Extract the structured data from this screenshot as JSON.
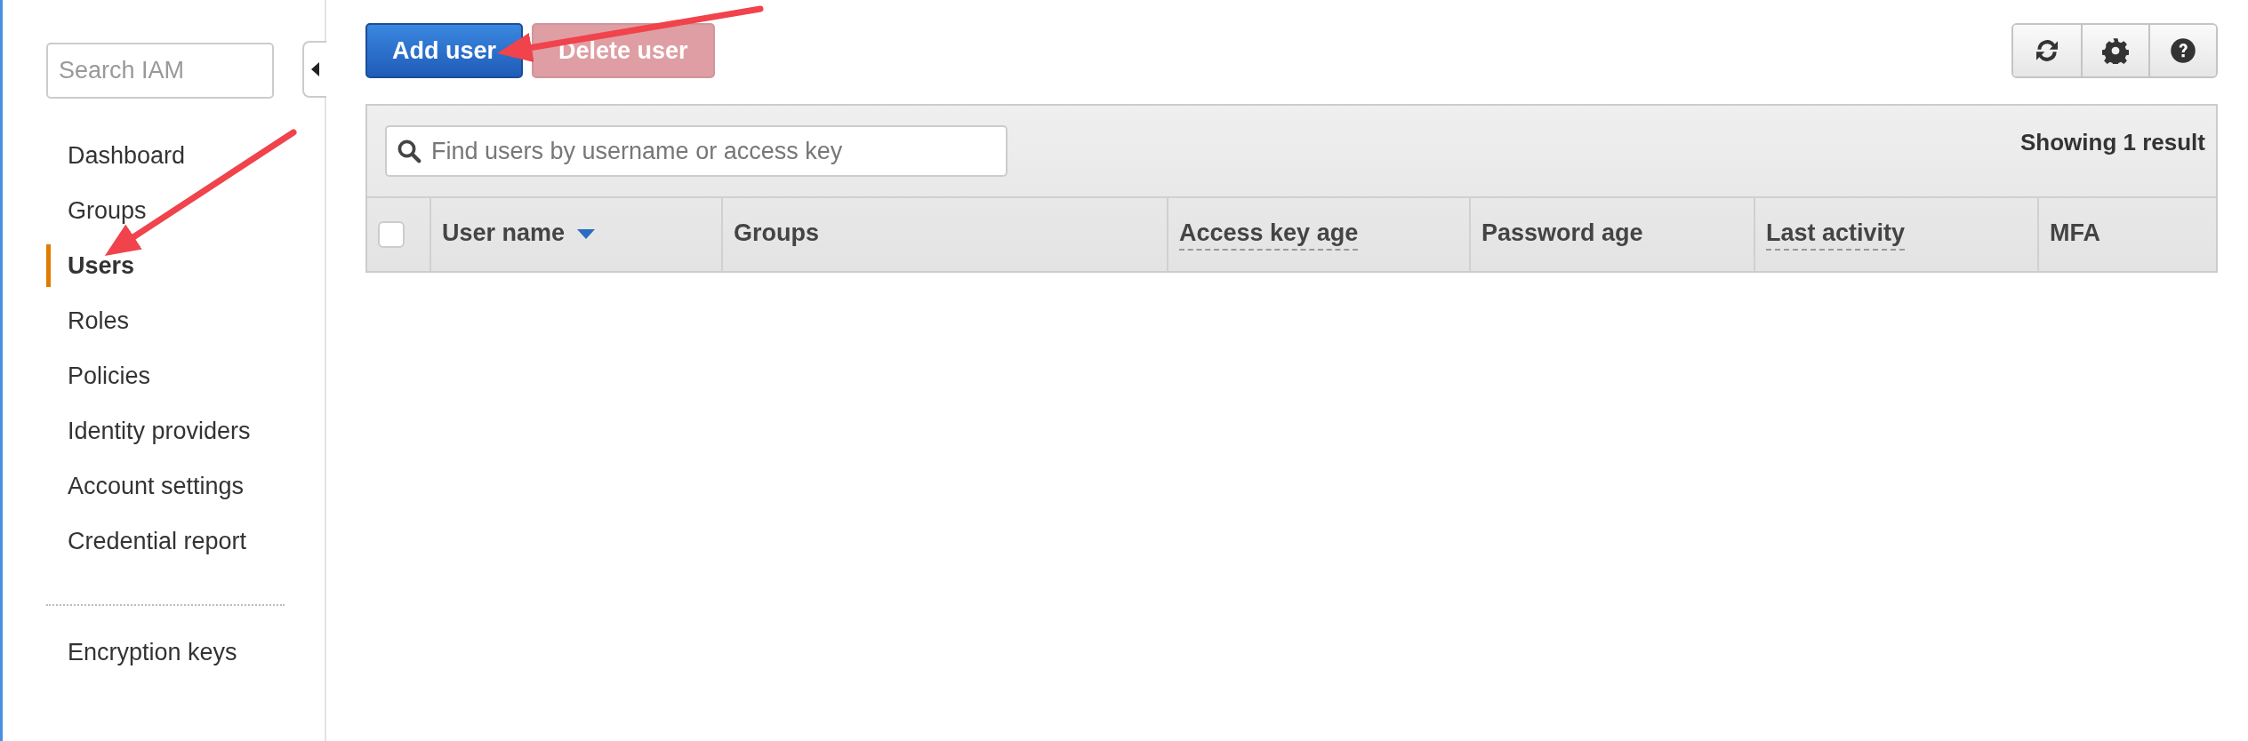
{
  "sidebar": {
    "search": {
      "placeholder": "Search IAM"
    },
    "items": [
      {
        "label": "Dashboard",
        "selected": false
      },
      {
        "label": "Groups",
        "selected": false
      },
      {
        "label": "Users",
        "selected": true
      },
      {
        "label": "Roles",
        "selected": false
      },
      {
        "label": "Policies",
        "selected": false
      },
      {
        "label": "Identity providers",
        "selected": false
      },
      {
        "label": "Account settings",
        "selected": false
      },
      {
        "label": "Credential report",
        "selected": false
      }
    ],
    "extra_items": [
      {
        "label": "Encryption keys",
        "selected": false
      }
    ]
  },
  "actions": [
    {
      "label": "Add user",
      "kind": "primary",
      "disabled": false
    },
    {
      "label": "Delete user",
      "kind": "danger",
      "disabled": true
    }
  ],
  "tool_buttons": [
    {
      "kind": "refresh"
    },
    {
      "kind": "settings"
    },
    {
      "kind": "help"
    }
  ],
  "table": {
    "search": {
      "placeholder": "Find users by username or access key"
    },
    "result_count": "Showing 1 result",
    "select_all": {
      "checked": false
    },
    "columns": [
      {
        "label": "User name",
        "sorted": true,
        "has_tooltip": false
      },
      {
        "label": "Groups",
        "sorted": false,
        "has_tooltip": false
      },
      {
        "label": "Access key age",
        "sorted": false,
        "has_tooltip": true
      },
      {
        "label": "Password age",
        "sorted": false,
        "has_tooltip": false
      },
      {
        "label": "Last activity",
        "sorted": false,
        "has_tooltip": true
      },
      {
        "label": "MFA",
        "sorted": false,
        "has_tooltip": false
      }
    ]
  },
  "annotations": [
    {
      "kind": "arrow"
    },
    {
      "kind": "arrow"
    }
  ]
}
